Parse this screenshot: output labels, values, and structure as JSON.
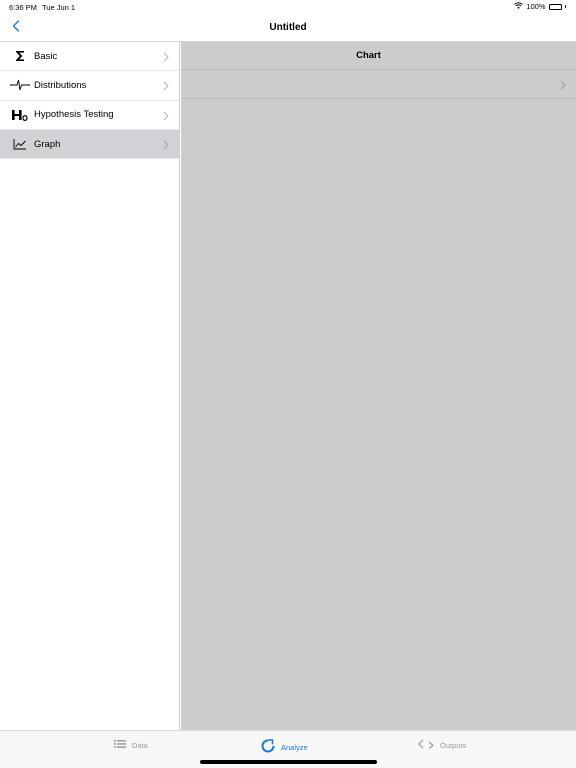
{
  "status_bar": {
    "time": "6:36 PM",
    "date": "Tue Jun 1",
    "battery": "100%",
    "icons": [
      "wifi-icon",
      "battery-icon"
    ]
  },
  "nav": {
    "title": "Untitled",
    "back_icon": "chevron-left-icon"
  },
  "sidebar": {
    "items": [
      {
        "label": "Basic",
        "icon": "sigma-icon"
      },
      {
        "label": "Distributions",
        "icon": "pulse-icon"
      },
      {
        "label": "Hypothesis Testing",
        "icon": "h0-icon"
      },
      {
        "label": "Graph",
        "icon": "line-graph-icon",
        "selected": true
      }
    ]
  },
  "detail": {
    "title": "Chart"
  },
  "tabs": [
    {
      "label": "Data",
      "icon": "list-icon"
    },
    {
      "label": "Analyze",
      "icon": "analyze-icon",
      "active": true
    },
    {
      "label": "Outputs",
      "icon": "code-icon"
    }
  ],
  "colors": {
    "accent": "#1a7ae0",
    "selected_row": "#d1d1d6",
    "detail_bg": "#cccccc",
    "tab_inactive": "#9a9a9a"
  }
}
